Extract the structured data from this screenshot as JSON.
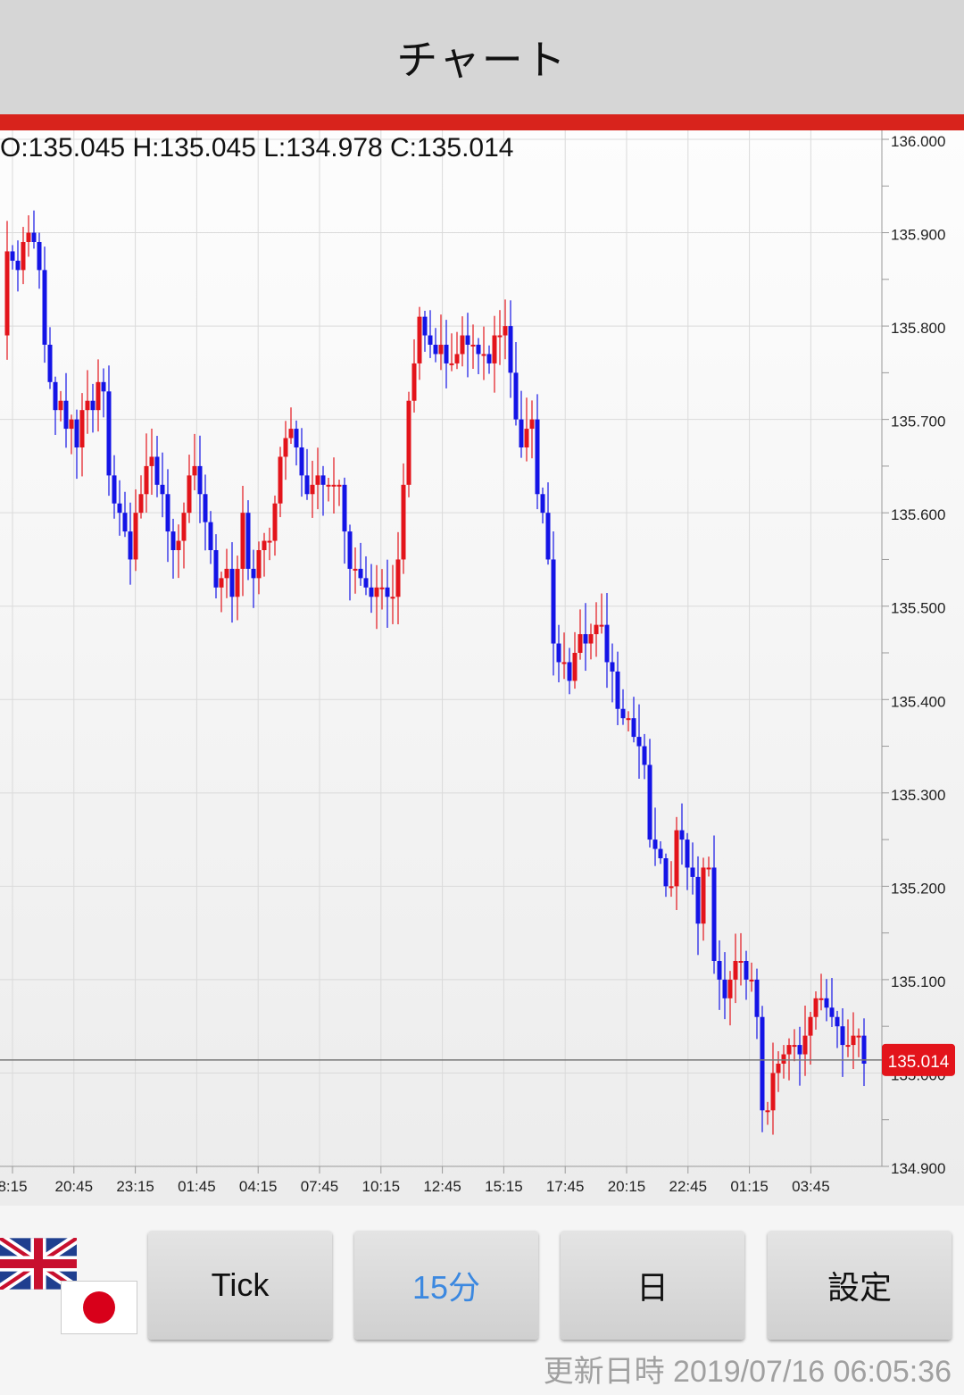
{
  "app": {
    "title": "チャート"
  },
  "ohlc": {
    "text": "O:135.045 H:135.045 L:134.978 C:135.014"
  },
  "current_price_label": "135.014",
  "toolbar": {
    "buttons": [
      {
        "label": "Tick",
        "active": false
      },
      {
        "label": "15分",
        "active": true
      },
      {
        "label": "日",
        "active": false
      },
      {
        "label": "設定",
        "active": false
      }
    ],
    "flags": [
      "uk-flag-icon",
      "jp-flag-icon"
    ]
  },
  "status": {
    "updated": "更新日時 2019/07/16 06:05:36"
  },
  "colors": {
    "up": "#e3141b",
    "down": "#1414e6",
    "accent": "#d8231c",
    "active_button": "#3b88e0"
  },
  "chart_data": {
    "type": "candlestick",
    "y_ticks": [
      "136.000",
      "135.900",
      "135.800",
      "135.700",
      "135.600",
      "135.500",
      "135.400",
      "135.300",
      "135.200",
      "135.100",
      "135.000",
      "134.900"
    ],
    "y_range": [
      134.9,
      136.0
    ],
    "x_ticks": [
      "8:15",
      "20:45",
      "23:15",
      "01:45",
      "04:15",
      "07:45",
      "10:15",
      "12:45",
      "15:15",
      "17:45",
      "20:15",
      "22:45",
      "01:15",
      "03:45"
    ],
    "current_price": 135.014,
    "grid": true,
    "path_points": [
      [
        0,
        135.79
      ],
      [
        6,
        135.88
      ],
      [
        12,
        135.87
      ],
      [
        18,
        135.86
      ],
      [
        24,
        135.89
      ],
      [
        30,
        135.9
      ],
      [
        36,
        135.89
      ],
      [
        42,
        135.86
      ],
      [
        48,
        135.78
      ],
      [
        54,
        135.74
      ],
      [
        60,
        135.71
      ],
      [
        66,
        135.72
      ],
      [
        72,
        135.69
      ],
      [
        78,
        135.7
      ],
      [
        84,
        135.67
      ],
      [
        90,
        135.71
      ],
      [
        96,
        135.72
      ],
      [
        102,
        135.71
      ],
      [
        108,
        135.74
      ],
      [
        114,
        135.73
      ],
      [
        120,
        135.64
      ],
      [
        126,
        135.61
      ],
      [
        132,
        135.6
      ],
      [
        138,
        135.58
      ],
      [
        144,
        135.55
      ],
      [
        150,
        135.6
      ],
      [
        156,
        135.62
      ],
      [
        162,
        135.65
      ],
      [
        168,
        135.66
      ],
      [
        174,
        135.63
      ],
      [
        180,
        135.62
      ],
      [
        186,
        135.58
      ],
      [
        192,
        135.56
      ],
      [
        198,
        135.57
      ],
      [
        204,
        135.6
      ],
      [
        210,
        135.64
      ],
      [
        216,
        135.65
      ],
      [
        222,
        135.62
      ],
      [
        228,
        135.59
      ],
      [
        234,
        135.56
      ],
      [
        240,
        135.52
      ],
      [
        246,
        135.53
      ],
      [
        252,
        135.54
      ],
      [
        258,
        135.51
      ],
      [
        264,
        135.54
      ],
      [
        270,
        135.6
      ],
      [
        276,
        135.54
      ],
      [
        282,
        135.53
      ],
      [
        288,
        135.56
      ],
      [
        294,
        135.57
      ],
      [
        300,
        135.57
      ],
      [
        306,
        135.61
      ],
      [
        312,
        135.66
      ],
      [
        318,
        135.68
      ],
      [
        324,
        135.69
      ],
      [
        330,
        135.67
      ],
      [
        336,
        135.64
      ],
      [
        342,
        135.62
      ],
      [
        348,
        135.63
      ],
      [
        354,
        135.64
      ],
      [
        360,
        135.63
      ],
      [
        366,
        135.63
      ],
      [
        372,
        135.63
      ],
      [
        378,
        135.63
      ],
      [
        384,
        135.58
      ],
      [
        390,
        135.54
      ],
      [
        396,
        135.54
      ],
      [
        402,
        135.53
      ],
      [
        408,
        135.52
      ],
      [
        414,
        135.51
      ],
      [
        420,
        135.52
      ],
      [
        426,
        135.52
      ],
      [
        432,
        135.51
      ],
      [
        438,
        135.51
      ],
      [
        444,
        135.55
      ],
      [
        450,
        135.63
      ],
      [
        456,
        135.72
      ],
      [
        462,
        135.76
      ],
      [
        468,
        135.81
      ],
      [
        474,
        135.79
      ],
      [
        480,
        135.78
      ],
      [
        486,
        135.77
      ],
      [
        492,
        135.78
      ],
      [
        498,
        135.76
      ],
      [
        504,
        135.76
      ],
      [
        510,
        135.77
      ],
      [
        516,
        135.79
      ],
      [
        522,
        135.78
      ],
      [
        528,
        135.78
      ],
      [
        534,
        135.77
      ],
      [
        540,
        135.77
      ],
      [
        546,
        135.76
      ],
      [
        552,
        135.79
      ],
      [
        558,
        135.79
      ],
      [
        564,
        135.8
      ],
      [
        570,
        135.75
      ],
      [
        576,
        135.7
      ],
      [
        582,
        135.67
      ],
      [
        588,
        135.69
      ],
      [
        594,
        135.7
      ],
      [
        600,
        135.62
      ],
      [
        606,
        135.6
      ],
      [
        612,
        135.55
      ],
      [
        618,
        135.46
      ],
      [
        624,
        135.44
      ],
      [
        630,
        135.44
      ],
      [
        636,
        135.42
      ],
      [
        642,
        135.45
      ],
      [
        648,
        135.47
      ],
      [
        654,
        135.46
      ],
      [
        660,
        135.47
      ],
      [
        666,
        135.48
      ],
      [
        672,
        135.48
      ],
      [
        678,
        135.44
      ],
      [
        684,
        135.43
      ],
      [
        690,
        135.39
      ],
      [
        696,
        135.38
      ],
      [
        702,
        135.38
      ],
      [
        708,
        135.36
      ],
      [
        714,
        135.35
      ],
      [
        720,
        135.33
      ],
      [
        726,
        135.25
      ],
      [
        732,
        135.24
      ],
      [
        738,
        135.23
      ],
      [
        744,
        135.2
      ],
      [
        750,
        135.2
      ],
      [
        756,
        135.26
      ],
      [
        762,
        135.25
      ],
      [
        768,
        135.22
      ],
      [
        774,
        135.21
      ],
      [
        780,
        135.16
      ],
      [
        786,
        135.22
      ],
      [
        792,
        135.22
      ],
      [
        798,
        135.12
      ],
      [
        804,
        135.1
      ],
      [
        810,
        135.08
      ],
      [
        816,
        135.1
      ],
      [
        822,
        135.12
      ],
      [
        828,
        135.12
      ],
      [
        834,
        135.1
      ],
      [
        840,
        135.1
      ],
      [
        846,
        135.06
      ],
      [
        852,
        134.96
      ],
      [
        858,
        134.96
      ],
      [
        864,
        135.0
      ],
      [
        870,
        135.01
      ],
      [
        876,
        135.02
      ],
      [
        882,
        135.03
      ],
      [
        888,
        135.03
      ],
      [
        894,
        135.02
      ],
      [
        900,
        135.04
      ],
      [
        906,
        135.06
      ],
      [
        912,
        135.08
      ],
      [
        918,
        135.08
      ],
      [
        924,
        135.07
      ],
      [
        930,
        135.06
      ],
      [
        936,
        135.05
      ],
      [
        942,
        135.03
      ],
      [
        948,
        135.03
      ],
      [
        954,
        135.04
      ],
      [
        960,
        135.04
      ],
      [
        966,
        135.01
      ]
    ]
  }
}
